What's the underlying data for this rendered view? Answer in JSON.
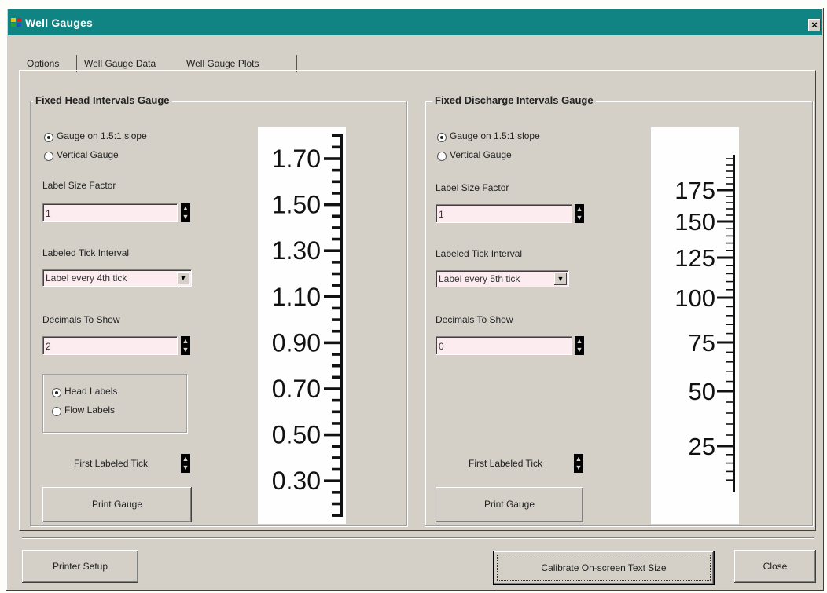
{
  "window": {
    "title": "Well Gauges",
    "close_glyph": "×"
  },
  "tabs": [
    {
      "label": "Options",
      "accel": "O",
      "active": false
    },
    {
      "label": "Well Gauge Data",
      "active": false
    },
    {
      "label": "Well Gauge Plots",
      "active": true
    }
  ],
  "head_gauge": {
    "title": "Fixed Head Intervals Gauge",
    "radio_slope": "Gauge on 1.5:1 slope",
    "radio_vertical": "Vertical Gauge",
    "label_size_label": "Label Size Factor",
    "label_size_value": "1",
    "tick_interval_label": "Labeled Tick Interval",
    "tick_interval_value": "Label every 4th tick",
    "decimals_label": "Decimals To Show",
    "decimals_value": "2",
    "radio_head_labels": "Head Labels",
    "radio_flow_labels": "Flow Labels",
    "first_tick_label": "First Labeled Tick",
    "print_button": "Print Gauge",
    "scale_labels": [
      "1.70",
      "1.50",
      "1.30",
      "1.10",
      "0.90",
      "0.70",
      "0.50",
      "0.30"
    ]
  },
  "discharge_gauge": {
    "title": "Fixed Discharge Intervals Gauge",
    "radio_slope": "Gauge on 1.5:1 slope",
    "radio_vertical": "Vertical Gauge",
    "label_size_label": "Label Size Factor",
    "label_size_value": "1",
    "tick_interval_label": "Labeled Tick Interval",
    "tick_interval_value": "Label every 5th tick",
    "decimals_label": "Decimals To Show",
    "decimals_value": "0",
    "first_tick_label": "First Labeled Tick",
    "print_button": "Print Gauge",
    "scale_labels": [
      "175",
      "150",
      "125",
      "100",
      "75",
      "50",
      "25"
    ]
  },
  "footer": {
    "printer_setup": "Printer Setup",
    "calibrate": "Calibrate On-screen Text Size",
    "close": "Close"
  },
  "colors": {
    "titlebar": "#0f8482",
    "dialog": "#d4d0c8",
    "field": "#fcecf0"
  }
}
